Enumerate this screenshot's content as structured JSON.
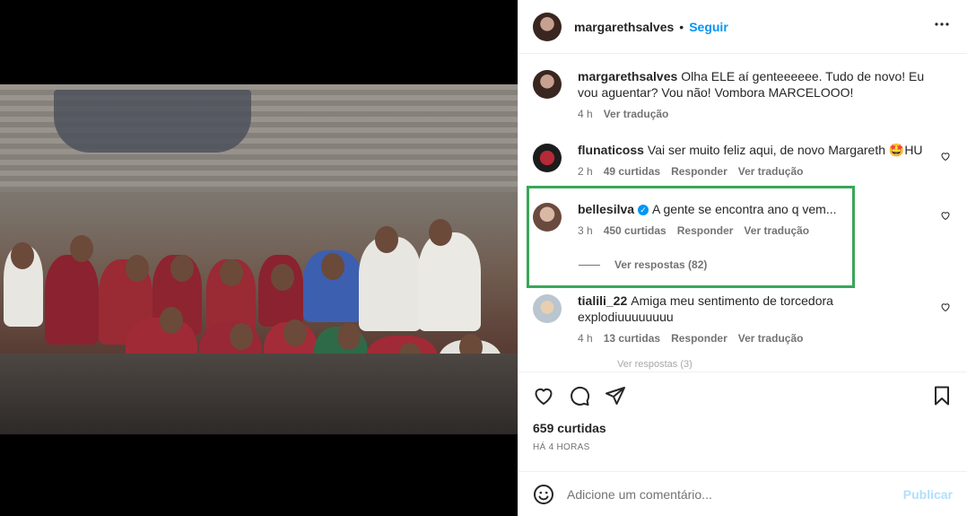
{
  "post": {
    "author": "margarethsalves",
    "follow_label": "Seguir",
    "dot": "•",
    "more_icon": "more-horizontal-icon"
  },
  "caption": {
    "author": "margarethsalves",
    "text": "Olha ELE aí genteeeeee. Tudo de novo! Eu vou aguentar? Vou não! Vombora MARCELOOO!",
    "time": "4 h",
    "translate": "Ver tradução"
  },
  "comments": [
    {
      "author": "flunaticoss",
      "text": "Vai ser muito feliz aqui, de novo Margareth 🤩HU",
      "time": "2 h",
      "likes": "49 curtidas",
      "reply": "Responder",
      "translate": "Ver tradução"
    },
    {
      "author": "bellesilva",
      "verified": true,
      "text": "A gente se encontra ano q vem...",
      "time": "3 h",
      "likes": "450 curtidas",
      "reply": "Responder",
      "translate": "Ver tradução",
      "replies_label": "Ver respostas (82)"
    },
    {
      "author": "tialili_22",
      "text": "Amiga meu sentimento de torcedora explodiuuuuuuuu",
      "time": "4 h",
      "likes": "13 curtidas",
      "reply": "Responder",
      "translate": "Ver tradução",
      "replies_label": "Ver respostas (3)"
    }
  ],
  "actions": {
    "like_icon": "heart-icon",
    "comment_icon": "comment-icon",
    "share_icon": "send-icon",
    "save_icon": "bookmark-icon"
  },
  "stats": {
    "likes": "659 curtidas",
    "posted": "HÁ 4 HORAS"
  },
  "add_comment": {
    "placeholder": "Adicione um comentário...",
    "publish_label": "Publicar"
  },
  "colors": {
    "accent": "#0095f6",
    "highlight": "#3aa65a",
    "publish_disabled": "#b2dffc"
  }
}
